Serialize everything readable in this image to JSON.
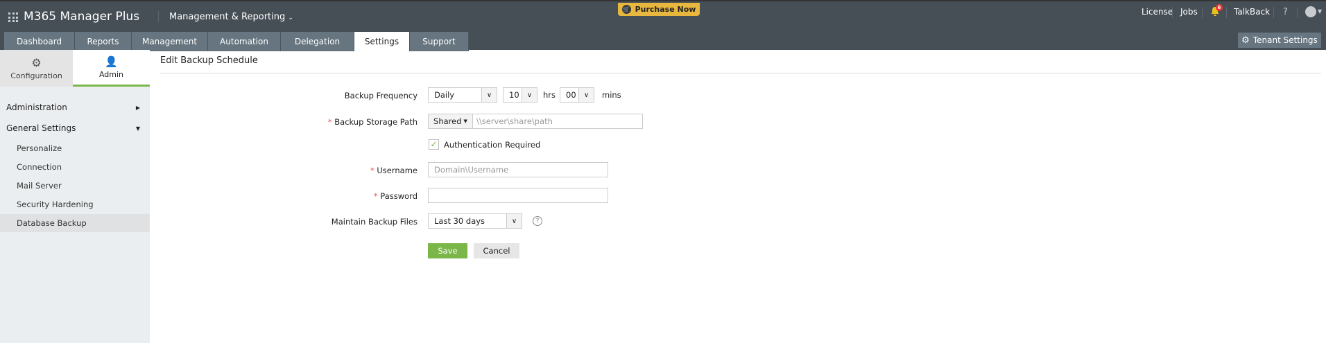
{
  "header": {
    "app_name": "M365 Manager Plus",
    "module": "Management & Reporting",
    "purchase": "Purchase Now",
    "links": {
      "license": "License",
      "jobs": "Jobs",
      "talkback": "TalkBack",
      "help": "?"
    },
    "notification_count": "6",
    "tenant_settings": "Tenant Settings"
  },
  "tabs": [
    "Dashboard",
    "Reports",
    "Management",
    "Automation",
    "Delegation",
    "Settings",
    "Support"
  ],
  "sidebar": {
    "tabs": {
      "configuration": "Configuration",
      "admin": "Admin"
    },
    "sections": {
      "administration": "Administration",
      "general_settings": "General Settings"
    },
    "items": [
      "Personalize",
      "Connection",
      "Mail Server",
      "Security Hardening",
      "Database Backup"
    ]
  },
  "form": {
    "title": "Edit Backup Schedule",
    "frequency_label": "Backup Frequency",
    "frequency": "Daily",
    "hours": "10",
    "hrs_unit": "hrs",
    "minutes": "00",
    "mins_unit": "mins",
    "storage_label": "Backup Storage Path",
    "storage_type": "Shared",
    "storage_placeholder": "\\\\server\\share\\path",
    "auth_label": "Authentication Required",
    "username_label": "Username",
    "username_placeholder": "Domain\\Username",
    "password_label": "Password",
    "maintain_label": "Maintain Backup Files",
    "maintain_value": "Last 30 days",
    "save": "Save",
    "cancel": "Cancel",
    "required_mark": "*"
  },
  "colors": {
    "accent": "#7ab648",
    "topbar": "#464f56",
    "purchase": "#e8b83e"
  }
}
